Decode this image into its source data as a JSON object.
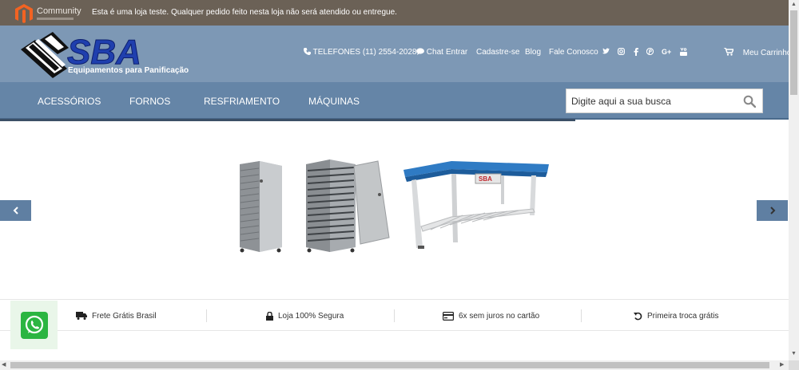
{
  "notice": {
    "platform_label": "Community",
    "message": "Esta é uma loja teste. Qualquer pedido feito nesta loja não será atendido ou entregue."
  },
  "header": {
    "brand": "SBA",
    "tagline": "Equipamentos para Panificação",
    "phone": "TELEFONES (11) 2554-2028",
    "chat": "Chat",
    "login": "Entrar",
    "register": "Cadastre-se",
    "blog": "Blog",
    "contact": "Fale Conosco",
    "cart": "Meu Carrinho",
    "social_icons": [
      "twitter-icon",
      "instagram-icon",
      "facebook-icon",
      "pinterest-icon",
      "google-plus-icon",
      "youtube-icon"
    ]
  },
  "nav": {
    "items": [
      "ACESSÓRIOS",
      "FORNOS",
      "RESFRIAMENTO",
      "MÁQUINAS"
    ],
    "search_placeholder": "Digite aqui a sua busca"
  },
  "banner": {
    "products": [
      "rack-closed",
      "rack-open",
      "blue-work-table"
    ],
    "prev_icon": "chevron-left-icon",
    "next_icon": "chevron-right-icon"
  },
  "features": [
    {
      "icon": "truck-icon",
      "label": "Frete Grátis Brasil"
    },
    {
      "icon": "lock-icon",
      "label": "Loja 100% Segura"
    },
    {
      "icon": "credit-card-icon",
      "label": "6x sem juros no cartão"
    },
    {
      "icon": "undo-icon",
      "label": "Primeira troca grátis"
    }
  ],
  "colors": {
    "notice_bg": "#6b6156",
    "header_bg": "#7d98b5",
    "nav_bg": "#6585a7",
    "brand_blue": "#1f3fae",
    "whatsapp_green": "#2bb541"
  }
}
